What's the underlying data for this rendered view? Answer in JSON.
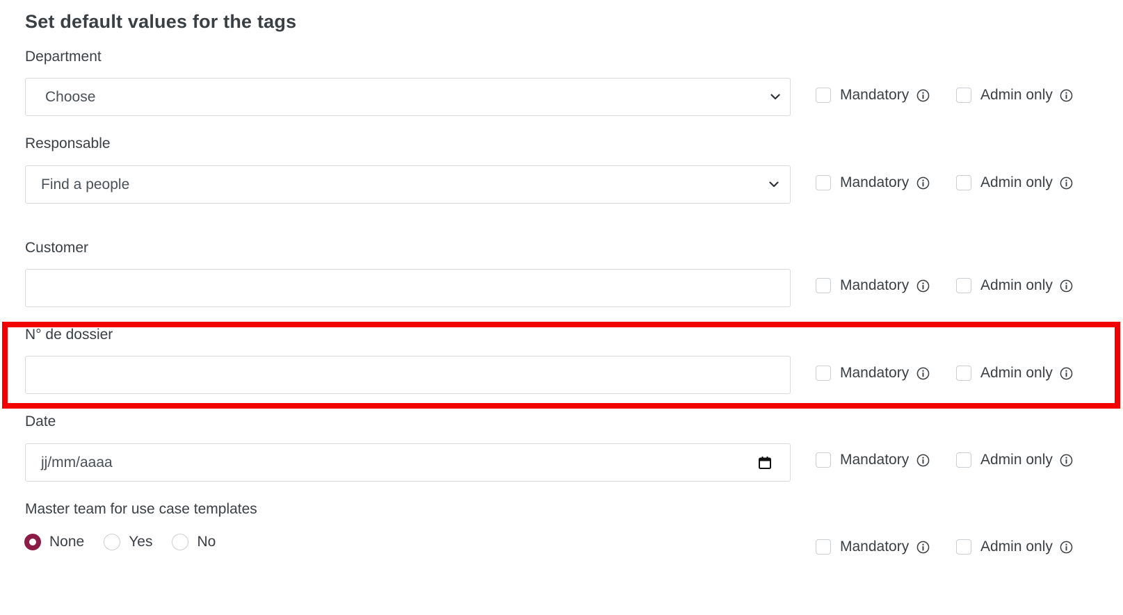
{
  "title": "Set default values for the tags",
  "option_labels": {
    "mandatory": "Mandatory",
    "admin_only": "Admin only"
  },
  "fields": {
    "department": {
      "label": "Department",
      "type": "select",
      "value": "Choose"
    },
    "responsable": {
      "label": "Responsable",
      "type": "select",
      "value": "Find a people"
    },
    "customer": {
      "label": "Customer",
      "type": "text",
      "value": ""
    },
    "dossier": {
      "label": "N° de dossier",
      "type": "text",
      "value": ""
    },
    "date": {
      "label": "Date",
      "type": "date",
      "value": "jj/mm/aaaa"
    },
    "master_team": {
      "label": "Master team for use case templates",
      "type": "radio",
      "options": [
        "None",
        "Yes",
        "No"
      ],
      "selected": "None"
    }
  },
  "colors": {
    "radio_selected": "#8c1c45",
    "highlight": "#f20000"
  },
  "icons": {
    "select": "chevron-down-icon",
    "date": "calendar-icon",
    "info": "info-icon"
  }
}
